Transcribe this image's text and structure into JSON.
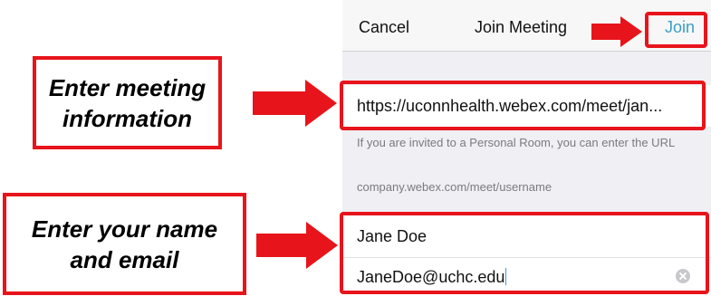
{
  "nav": {
    "cancel_label": "Cancel",
    "title": "Join Meeting",
    "join_label": "Join"
  },
  "meeting": {
    "url_value": "https://uconnhealth.webex.com/meet/jan...",
    "hint_text": "If you are invited to a Personal Room, you can enter the URL",
    "example_text": "company.webex.com/meet/username"
  },
  "attendee": {
    "name_value": "Jane Doe",
    "email_value": "JaneDoe@uchc.edu"
  },
  "callouts": {
    "meeting_line1": "Enter meeting",
    "meeting_line2": "information",
    "name_line1": "Enter your name",
    "name_line2": "and email"
  },
  "icons": {
    "clear": "clear-circle-icon",
    "arrow": "right-arrow-icon"
  },
  "colors": {
    "highlight": "#e8141b",
    "link": "#3a9fc3",
    "background": "#efeff4"
  }
}
